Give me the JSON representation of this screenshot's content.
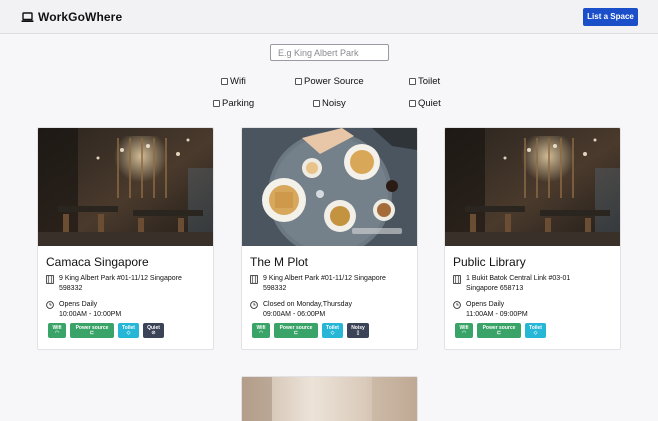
{
  "app": {
    "brand": "WorkGoWhere",
    "list_button": "List a Space"
  },
  "search": {
    "placeholder": "E.g King Albert Park"
  },
  "filters": [
    "Wifi",
    "Power Source",
    "Toilet",
    "Parking",
    "Noisy",
    "Quiet"
  ],
  "cards": [
    {
      "title": "Camaca Singapore",
      "address_1": "9 King Albert Park #01-11/12 Singapore",
      "address_2": "598332",
      "hours_1": "Opens Daily",
      "hours_2": "10:00AM - 10:00PM",
      "tags": [
        "Wifi",
        "Power source",
        "Toilet",
        "Quiet"
      ]
    },
    {
      "title": "The M Plot",
      "address_1": "9 King Albert Park #01-11/12 Singapore",
      "address_2": "598332",
      "hours_1": "Closed on Monday,Thursday",
      "hours_2": "09:00AM - 06:00PM",
      "tags": [
        "Wifi",
        "Power source",
        "Toilet",
        "Noisy"
      ]
    },
    {
      "title": "Public Library",
      "address_1": "1 Bukit Batok Central Link #03-01",
      "address_2": "Singapore 658713",
      "hours_1": "Opens Daily",
      "hours_2": "11:00AM - 09:00PM",
      "tags": [
        "Wifi",
        "Power source",
        "Toilet"
      ]
    }
  ],
  "icons": {
    "brand": "laptop-icon",
    "address": "building-icon",
    "hours": "clock-icon",
    "wifi": "wifi-icon",
    "power": "plug-icon",
    "toilet": "drop-icon",
    "quiet": "mute-icon",
    "noisy": "speaker-icon"
  },
  "colors": {
    "primary": "#1a4fc9",
    "tag_green": "#3aa368",
    "tag_cyan": "#26b6d6",
    "tag_dark": "#3b4356"
  }
}
